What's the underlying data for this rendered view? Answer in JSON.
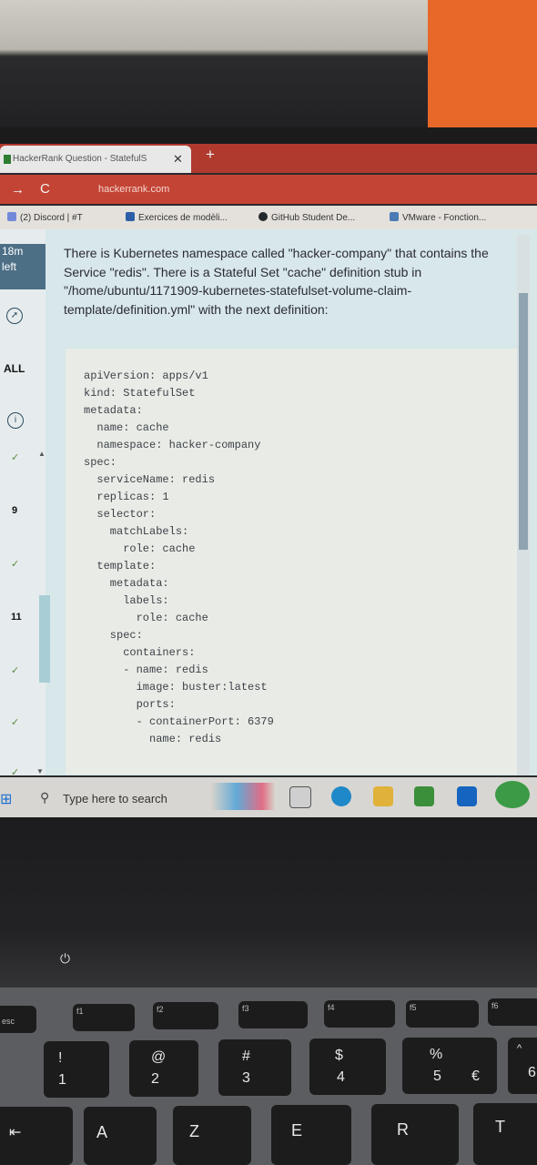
{
  "browser": {
    "tab_title": "HackerRank Question - StatefulS",
    "tab_close": "✕",
    "new_tab": "+",
    "nav_forward": "→",
    "nav_reload": "C",
    "url": "hackerrank.com",
    "bookmarks": [
      {
        "label": "(2) Discord | #T",
        "color": "#7289da"
      },
      {
        "label": "Exercices de modèli...",
        "color": "#2d5fa8"
      },
      {
        "label": "GitHub Student De...",
        "color": "#24292e"
      },
      {
        "label": "VMware - Fonction...",
        "color": "#4a7bb5"
      }
    ]
  },
  "sidebar": {
    "timer_line1": "18m",
    "timer_line2": "left",
    "all_label": "ALL",
    "info_icon": "i",
    "num_9": "9",
    "num_11": "11",
    "check": "✓"
  },
  "question": {
    "text": "There is Kubernetes namespace called \"hacker-company\" that contains the Service \"redis\". There is a Stateful Set \"cache\" definition stub in \"/home/ubuntu/1171909-kubernetes-statefulset-volume-claim-template/definition.yml\" with the next definition:",
    "code": "apiVersion: apps/v1\nkind: StatefulSet\nmetadata:\n  name: cache\n  namespace: hacker-company\nspec:\n  serviceName: redis\n  replicas: 1\n  selector:\n    matchLabels:\n      role: cache\n  template:\n    metadata:\n      labels:\n        role: cache\n    spec:\n      containers:\n      - name: redis\n        image: buster:latest\n        ports:\n        - containerPort: 6379\n          name: redis"
  },
  "taskbar": {
    "search_placeholder": "Type here to search",
    "search_icon": "⚲",
    "start_icon": "⊞",
    "icons": [
      {
        "name": "task-view-icon",
        "color": "#c9c9c9"
      },
      {
        "name": "edge-icon",
        "color": "#1e88c8"
      },
      {
        "name": "file-explorer-icon",
        "color": "#e0b23a"
      },
      {
        "name": "store-icon",
        "color": "#3b8f3b"
      },
      {
        "name": "mail-icon",
        "color": "#1565c0"
      },
      {
        "name": "chrome-icon",
        "color": "#3b9a46"
      }
    ]
  },
  "keyboard": {
    "power_icon": "⏻",
    "keys_row_fn": [
      "esc",
      "f1",
      "f2",
      "f3",
      "f4",
      "f5",
      "f6"
    ],
    "keys_row_num": [
      {
        "main": "1",
        "shift": "!"
      },
      {
        "main": "2",
        "shift": "@"
      },
      {
        "main": "3",
        "shift": "#"
      },
      {
        "main": "4",
        "shift": "$"
      },
      {
        "main": "5",
        "shift": "%",
        "alt": "€"
      },
      {
        "main": "6",
        "shift": "^"
      }
    ],
    "keys_row_alpha": [
      "A",
      "Z",
      "E",
      "R",
      "T"
    ],
    "tab_glyph": "⇤"
  }
}
